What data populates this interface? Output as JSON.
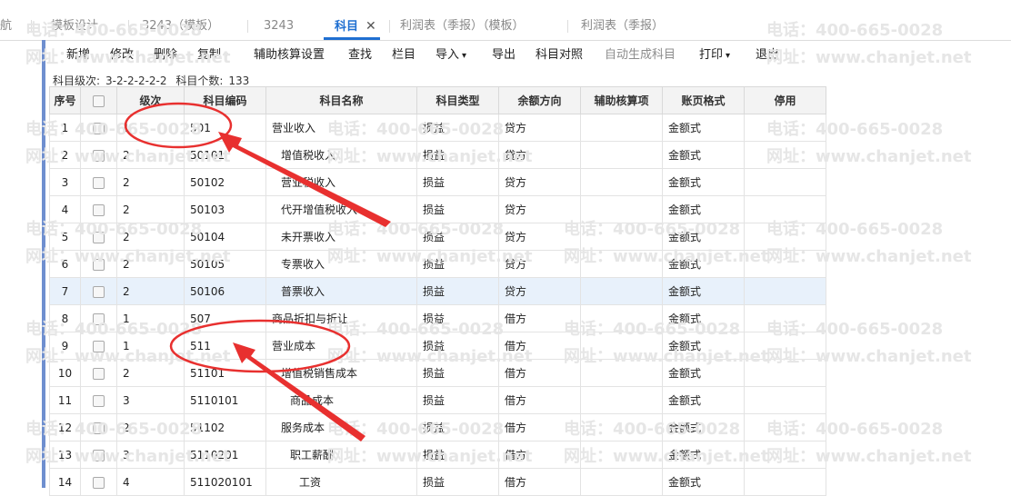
{
  "tabs": [
    {
      "label": "航"
    },
    {
      "label": "模板设计"
    },
    {
      "label": "3243（模板）"
    },
    {
      "label": "3243"
    },
    {
      "label": "科目",
      "active": true,
      "close": "✕"
    },
    {
      "label": "利润表（季报）（模板）"
    },
    {
      "label": "利润表（季报）"
    }
  ],
  "toolbar": [
    {
      "label": "新增"
    },
    {
      "label": "修改"
    },
    {
      "label": "删除"
    },
    {
      "label": "复制",
      "caret": true
    },
    {
      "label": "辅助核算设置"
    },
    {
      "label": "查找"
    },
    {
      "label": "栏目"
    },
    {
      "label": "导入",
      "caret": true
    },
    {
      "label": "导出"
    },
    {
      "label": "科目对照"
    },
    {
      "label": "自动生成科目",
      "disabled": true
    },
    {
      "label": "打印",
      "caret": true
    },
    {
      "label": "退出"
    }
  ],
  "info": {
    "level_label": "科目级次:",
    "level_value": "3-2-2-2-2-2",
    "count_label": "科目个数:",
    "count_value": "133"
  },
  "table": {
    "headers": [
      "序号",
      "",
      "级次",
      "科目编码",
      "科目名称",
      "科目类型",
      "余额方向",
      "辅助核算项",
      "账页格式",
      "停用"
    ],
    "rows": [
      {
        "seq": "1",
        "level": "1",
        "code": "501",
        "name": "营业收入",
        "indent": 0,
        "type": "损益",
        "dir": "贷方",
        "aux": "",
        "fmt": "金额式",
        "disabled": ""
      },
      {
        "seq": "2",
        "level": "2",
        "code": "50101",
        "name": "增值税收入",
        "indent": 1,
        "type": "损益",
        "dir": "贷方",
        "aux": "",
        "fmt": "金额式",
        "disabled": ""
      },
      {
        "seq": "3",
        "level": "2",
        "code": "50102",
        "name": "营业税收入",
        "indent": 1,
        "type": "损益",
        "dir": "贷方",
        "aux": "",
        "fmt": "金额式",
        "disabled": ""
      },
      {
        "seq": "4",
        "level": "2",
        "code": "50103",
        "name": "代开增值税收入",
        "indent": 1,
        "type": "损益",
        "dir": "贷方",
        "aux": "",
        "fmt": "金额式",
        "disabled": ""
      },
      {
        "seq": "5",
        "level": "2",
        "code": "50104",
        "name": "未开票收入",
        "indent": 1,
        "type": "损益",
        "dir": "贷方",
        "aux": "",
        "fmt": "金额式",
        "disabled": ""
      },
      {
        "seq": "6",
        "level": "2",
        "code": "50105",
        "name": "专票收入",
        "indent": 1,
        "type": "损益",
        "dir": "贷方",
        "aux": "",
        "fmt": "金额式",
        "disabled": ""
      },
      {
        "seq": "7",
        "level": "2",
        "code": "50106",
        "name": "普票收入",
        "indent": 1,
        "type": "损益",
        "dir": "贷方",
        "aux": "",
        "fmt": "金额式",
        "disabled": "",
        "selected": true
      },
      {
        "seq": "8",
        "level": "1",
        "code": "507",
        "name": "商品折扣与折让",
        "indent": 0,
        "type": "损益",
        "dir": "借方",
        "aux": "",
        "fmt": "金额式",
        "disabled": ""
      },
      {
        "seq": "9",
        "level": "1",
        "code": "511",
        "name": "营业成本",
        "indent": 0,
        "type": "损益",
        "dir": "借方",
        "aux": "",
        "fmt": "金额式",
        "disabled": ""
      },
      {
        "seq": "10",
        "level": "2",
        "code": "51101",
        "name": "增值税销售成本",
        "indent": 1,
        "type": "损益",
        "dir": "借方",
        "aux": "",
        "fmt": "金额式",
        "disabled": ""
      },
      {
        "seq": "11",
        "level": "3",
        "code": "5110101",
        "name": "商品成本",
        "indent": 2,
        "type": "损益",
        "dir": "借方",
        "aux": "",
        "fmt": "金额式",
        "disabled": ""
      },
      {
        "seq": "12",
        "level": "2",
        "code": "51102",
        "name": "服务成本",
        "indent": 1,
        "type": "损益",
        "dir": "借方",
        "aux": "",
        "fmt": "金额式",
        "disabled": ""
      },
      {
        "seq": "13",
        "level": "3",
        "code": "5110201",
        "name": "职工薪酬",
        "indent": 2,
        "type": "损益",
        "dir": "借方",
        "aux": "",
        "fmt": "金额式",
        "disabled": ""
      },
      {
        "seq": "14",
        "level": "4",
        "code": "511020101",
        "name": "工资",
        "indent": 3,
        "type": "损益",
        "dir": "借方",
        "aux": "",
        "fmt": "金额式",
        "disabled": ""
      }
    ]
  },
  "watermark": {
    "phone": "电话：400-665-0028",
    "site": "网址：www.chanjet.net"
  },
  "annotation": {
    "color": "#e8302f"
  },
  "colors": {
    "accent": "#1f6fd1",
    "leftbar": "#6f8fcf",
    "selected_row": "#e8f1fb"
  }
}
